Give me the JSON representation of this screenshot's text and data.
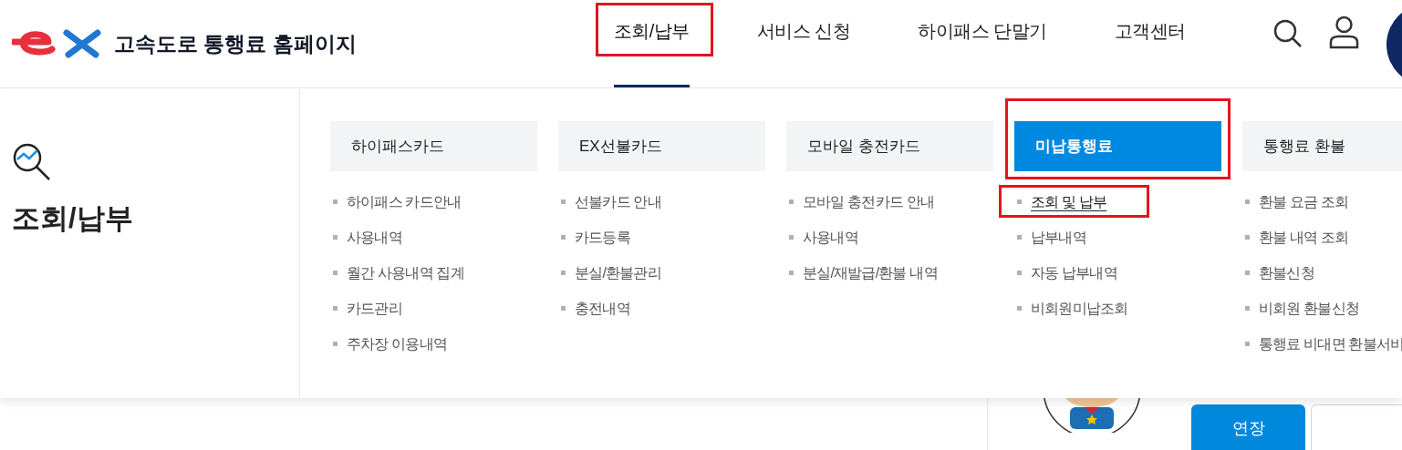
{
  "site": {
    "title": "고속도로 통행료 홈페이지"
  },
  "nav": [
    {
      "label": "조회/납부",
      "selected": true,
      "annotated": true
    },
    {
      "label": "서비스 신청",
      "selected": false
    },
    {
      "label": "하이패스 단말기",
      "selected": false
    },
    {
      "label": "고객센터",
      "selected": false
    }
  ],
  "menu": {
    "title": "조회/납부",
    "columns": [
      {
        "heading": "하이패스카드",
        "selected": false,
        "items": [
          {
            "label": "하이패스 카드안내",
            "selected": false
          },
          {
            "label": "사용내역",
            "selected": false
          },
          {
            "label": "월간 사용내역 집계",
            "selected": false
          },
          {
            "label": "카드관리",
            "selected": false
          },
          {
            "label": "주차장 이용내역",
            "selected": false
          }
        ]
      },
      {
        "heading": "EX선불카드",
        "selected": false,
        "items": [
          {
            "label": "선불카드 안내",
            "selected": false
          },
          {
            "label": "카드등록",
            "selected": false
          },
          {
            "label": "분실/환불관리",
            "selected": false
          },
          {
            "label": "충전내역",
            "selected": false
          }
        ]
      },
      {
        "heading": "모바일 충전카드",
        "selected": false,
        "items": [
          {
            "label": "모바일 충전카드 안내",
            "selected": false
          },
          {
            "label": "사용내역",
            "selected": false
          },
          {
            "label": "분실/재발급/환불 내역",
            "selected": false
          }
        ]
      },
      {
        "heading": "미납통행료",
        "selected": true,
        "annotated": true,
        "items": [
          {
            "label": "조회 및 납부",
            "selected": true,
            "annotated": true
          },
          {
            "label": "납부내역",
            "selected": false
          },
          {
            "label": "자동 납부내역",
            "selected": false
          },
          {
            "label": "비회원미납조회",
            "selected": false
          }
        ]
      },
      {
        "heading": "통행료 환불",
        "selected": false,
        "items": [
          {
            "label": "환불 요금 조회",
            "selected": false
          },
          {
            "label": "환불 내역 조회",
            "selected": false
          },
          {
            "label": "환불신청",
            "selected": false
          },
          {
            "label": "비회원 환불신청",
            "selected": false
          },
          {
            "label": "통행료 비대면 환불서비",
            "selected": false
          }
        ]
      }
    ]
  },
  "behind": {
    "button": "연장"
  }
}
